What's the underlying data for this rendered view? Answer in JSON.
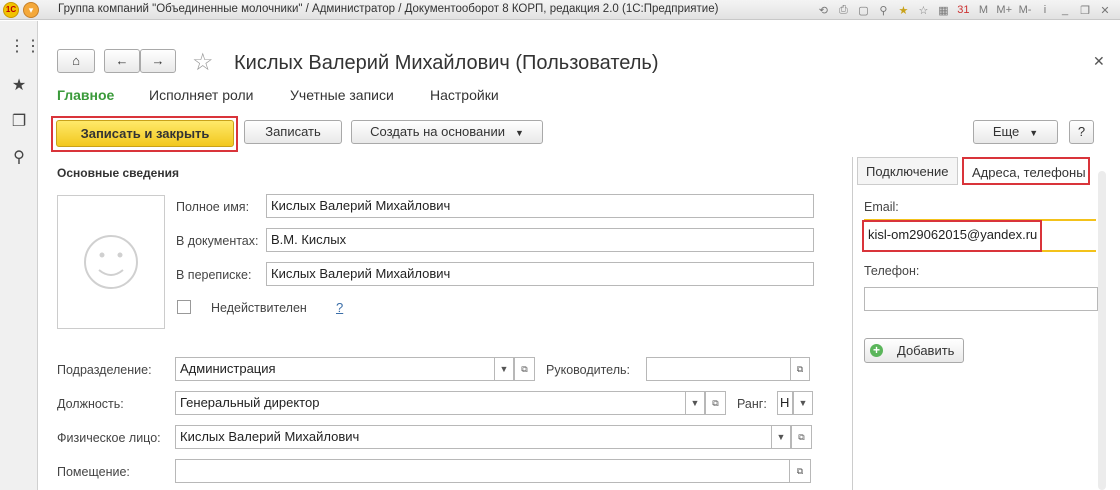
{
  "titlebar": {
    "title": "Группа компаний \"Объединенные молочники\" / Администратор / Документооборот 8 КОРП, редакция 2.0  (1С:Предприятие)",
    "icons": [
      "M",
      "M+",
      "M-",
      "i"
    ]
  },
  "form": {
    "title": "Кислых Валерий Михайлович (Пользователь)",
    "tabs": [
      "Главное",
      "Исполняет роли",
      "Учетные записи",
      "Настройки"
    ]
  },
  "toolbar": {
    "save_close": "Записать и закрыть",
    "save": "Записать",
    "create_based": "Создать на основании",
    "more": "Еще",
    "help": "?"
  },
  "main": {
    "section_title": "Основные сведения",
    "full_name_label": "Полное имя:",
    "full_name": "Кислых Валерий Михайлович",
    "in_docs_label": "В документах:",
    "in_docs": "В.М. Кислых",
    "in_mail_label": "В переписке:",
    "in_mail": "Кислых Валерий Михайлович",
    "invalid_label": "Недействителен",
    "help_link": "?",
    "department_label": "Подразделение:",
    "department": "Администрация",
    "manager_label": "Руководитель:",
    "manager": "",
    "position_label": "Должность:",
    "position": "Генеральный директор",
    "rank_label": "Ранг:",
    "rank": "Н",
    "person_label": "Физическое лицо:",
    "person": "Кислых Валерий Михайлович",
    "room_label": "Помещение:",
    "room": ""
  },
  "side": {
    "tab_connection": "Подключение",
    "tab_addresses": "Адреса, телефоны",
    "email_label": "Email:",
    "email": "kisl-om29062015@yandex.ru",
    "phone_label": "Телефон:",
    "phone": "",
    "add_button": "Добавить"
  },
  "colors": {
    "accent_green": "#3a9a3a",
    "primary_yellow": "#f2c81e",
    "highlight_red": "#d9343a"
  }
}
